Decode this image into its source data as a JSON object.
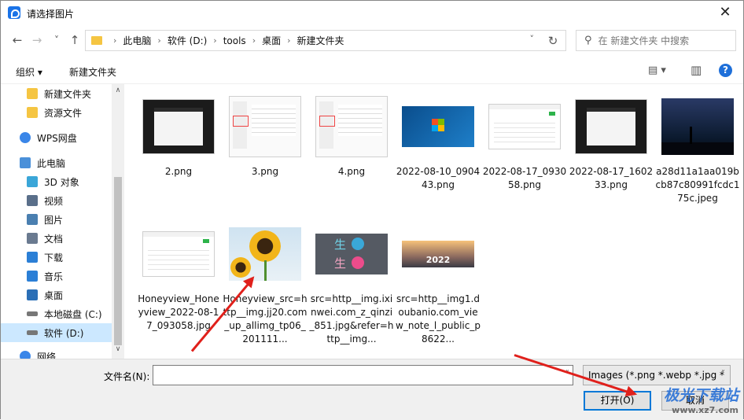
{
  "window": {
    "title": "请选择图片",
    "close_glyph": "✕"
  },
  "nav": {
    "back": "←",
    "forward": "→",
    "recent": "˅",
    "up": "↑",
    "breadcrumb": [
      "此电脑",
      "软件 (D:)",
      "tools",
      "桌面",
      "新建文件夹"
    ],
    "separator": "›",
    "dropdown_glyph": "˅",
    "refresh_glyph": "↻",
    "search_placeholder": "在 新建文件夹 中搜索",
    "search_glyph": "⚲"
  },
  "toolbar": {
    "organize": "组织 ▾",
    "new_folder": "新建文件夹",
    "view_glyph": "▤ ▾",
    "pane_glyph": "▥",
    "help": "?"
  },
  "sidebar": {
    "items": [
      {
        "label": "新建文件夹",
        "icon": "folder-icon",
        "color": "#f5c542"
      },
      {
        "label": "资源文件",
        "icon": "folder-icon",
        "color": "#f5c542"
      },
      {
        "label": "WPS网盘",
        "icon": "cloud-icon",
        "color": "#3a86e8"
      },
      {
        "label": "此电脑",
        "icon": "computer-icon",
        "color": "#4a90d9"
      },
      {
        "label": "3D 对象",
        "icon": "cube-icon",
        "color": "#3aa6d8"
      },
      {
        "label": "视频",
        "icon": "video-icon",
        "color": "#5a6f8a"
      },
      {
        "label": "图片",
        "icon": "picture-icon",
        "color": "#4a7fb0"
      },
      {
        "label": "文档",
        "icon": "document-icon",
        "color": "#6a7a90"
      },
      {
        "label": "下载",
        "icon": "download-icon",
        "color": "#2b7fd6"
      },
      {
        "label": "音乐",
        "icon": "music-icon",
        "color": "#2b7fd6"
      },
      {
        "label": "桌面",
        "icon": "desktop-icon",
        "color": "#2b6fb6"
      },
      {
        "label": "本地磁盘 (C:)",
        "icon": "drive-icon",
        "color": "#777777"
      },
      {
        "label": "软件 (D:)",
        "icon": "drive-icon",
        "color": "#777777"
      },
      {
        "label": "网络",
        "icon": "network-icon",
        "color": "#3a86e8"
      }
    ],
    "selected_index": 12,
    "scroll_up": "∧",
    "scroll_down": "∨"
  },
  "files": [
    {
      "name": "2.png",
      "thumb": "screenshot-dark"
    },
    {
      "name": "3.png",
      "thumb": "screenshot-doc"
    },
    {
      "name": "4.png",
      "thumb": "screenshot-doc"
    },
    {
      "name": "2022-08-10_090443.png",
      "thumb": "windows-logo"
    },
    {
      "name": "2022-08-17_093058.png",
      "thumb": "screenshot-light"
    },
    {
      "name": "2022-08-17_160233.png",
      "thumb": "screenshot-dark"
    },
    {
      "name": "a28d11a1aa019bcb87c80991fcdc175c.jpeg",
      "thumb": "night-sky"
    },
    {
      "name": "Honeyview_Honeyview_2022-08-17_093058.jpg",
      "thumb": "screenshot-light"
    },
    {
      "name": "Honeyview_src=http__img.jj20.com_up_allimg_tp06_201111...",
      "thumb": "sunflower"
    },
    {
      "name": "src=http__img.ixinwei.com_z_qinzi_851.jpg&refer=http__img...",
      "thumb": "sheng-logo"
    },
    {
      "name": "src=http__img1.doubanio.com_view_note_l_public_p8622...",
      "thumb": "road-2022"
    }
  ],
  "thumb_text": {
    "sheng": "生",
    "road_year": "2022"
  },
  "bottom": {
    "filename_label": "文件名(N):",
    "filename_value": "",
    "filetype": "Images (*.png *.webp *.jpg *",
    "open": "打开(O)",
    "cancel": "取消"
  },
  "watermark": {
    "brand": "极光下载站",
    "url": "www.xz7.com"
  },
  "colors": {
    "selection": "#cce8ff",
    "accent": "#0078d7",
    "arrow": "#e0201b"
  }
}
